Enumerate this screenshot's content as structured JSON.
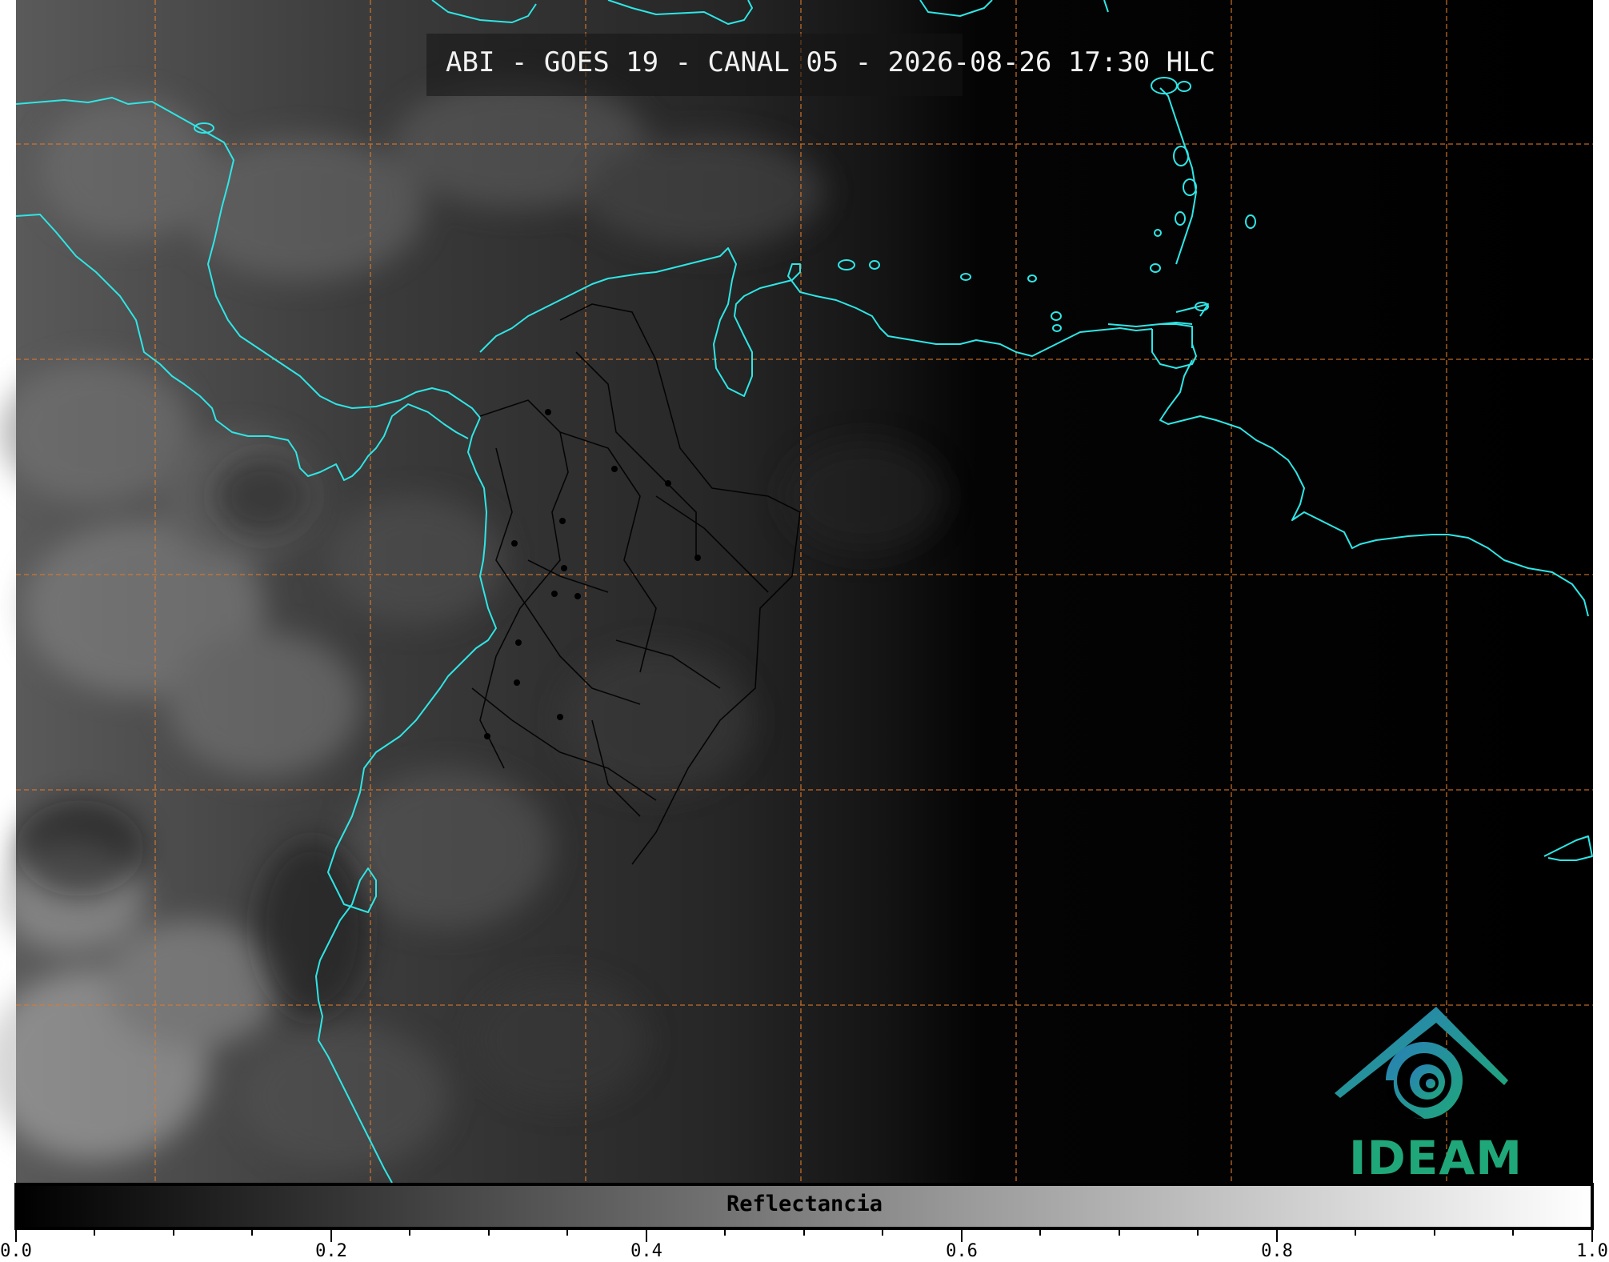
{
  "title": "ABI - GOES 19 - CANAL 05 - 2026-08-26 17:30 HLC",
  "colorbar": {
    "label": "Reflectancia",
    "ticks": [
      "0.0",
      "0.2",
      "0.4",
      "0.6",
      "0.8",
      "1.0"
    ],
    "min": 0.0,
    "max": 1.0,
    "colormap": "grayscale",
    "start_color": "#000000",
    "end_color": "#ffffff"
  },
  "logo": {
    "text": "IDEAM",
    "color": "#1fa77a",
    "accent": "#2a7fb8"
  },
  "colors": {
    "coastline": "#2fe6e6",
    "borders": "#000000",
    "graticule": "#e07a2a",
    "clouds_west": "#6e6e6e",
    "background_east": "#000000"
  },
  "map": {
    "graticule": "dashed",
    "night_side": "east"
  }
}
